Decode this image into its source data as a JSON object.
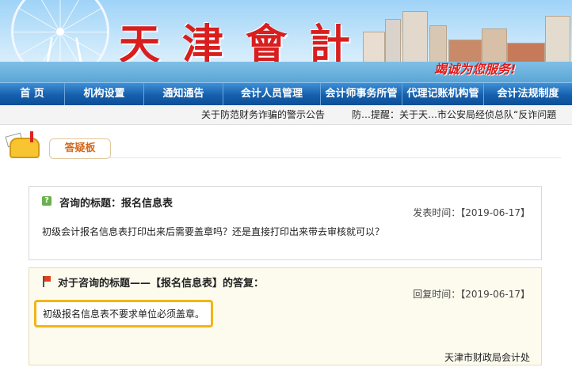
{
  "banner": {
    "logo_text": "天津會計",
    "slogan": "竭诚为您服务!"
  },
  "nav": {
    "items": [
      {
        "label": "首 页"
      },
      {
        "label": "机构设置"
      },
      {
        "label": "通知通告"
      },
      {
        "label": "会计人员管理"
      },
      {
        "label": "会计师事务所管"
      },
      {
        "label": "代理记账机构管"
      },
      {
        "label": "会计法规制度"
      }
    ]
  },
  "ticker": {
    "item1": "关于防范财务诈骗的警示公告",
    "item2": "防…提醒：关于天…市公安局经侦总队“反诈问題"
  },
  "board": {
    "title": "答疑板"
  },
  "question": {
    "title": "咨询的标题：报名信息表",
    "time": "发表时间：【2019-06-17】",
    "body": "初级会计报名信息表打印出来后需要盖章吗？还是直接打印出来带去审核就可以？"
  },
  "answer": {
    "title": "对于咨询的标题——【报名信息表】的答复：",
    "time": "回复时间：【2019-06-17】",
    "body": "初级报名信息表不要求单位必须盖章。",
    "signature": "天津市财政局会计处"
  },
  "colors": {
    "nav_bg": "#1660ad",
    "logo_red": "#d81e1e",
    "highlight_border": "#f3b416",
    "answer_bg": "#fdfbee"
  }
}
